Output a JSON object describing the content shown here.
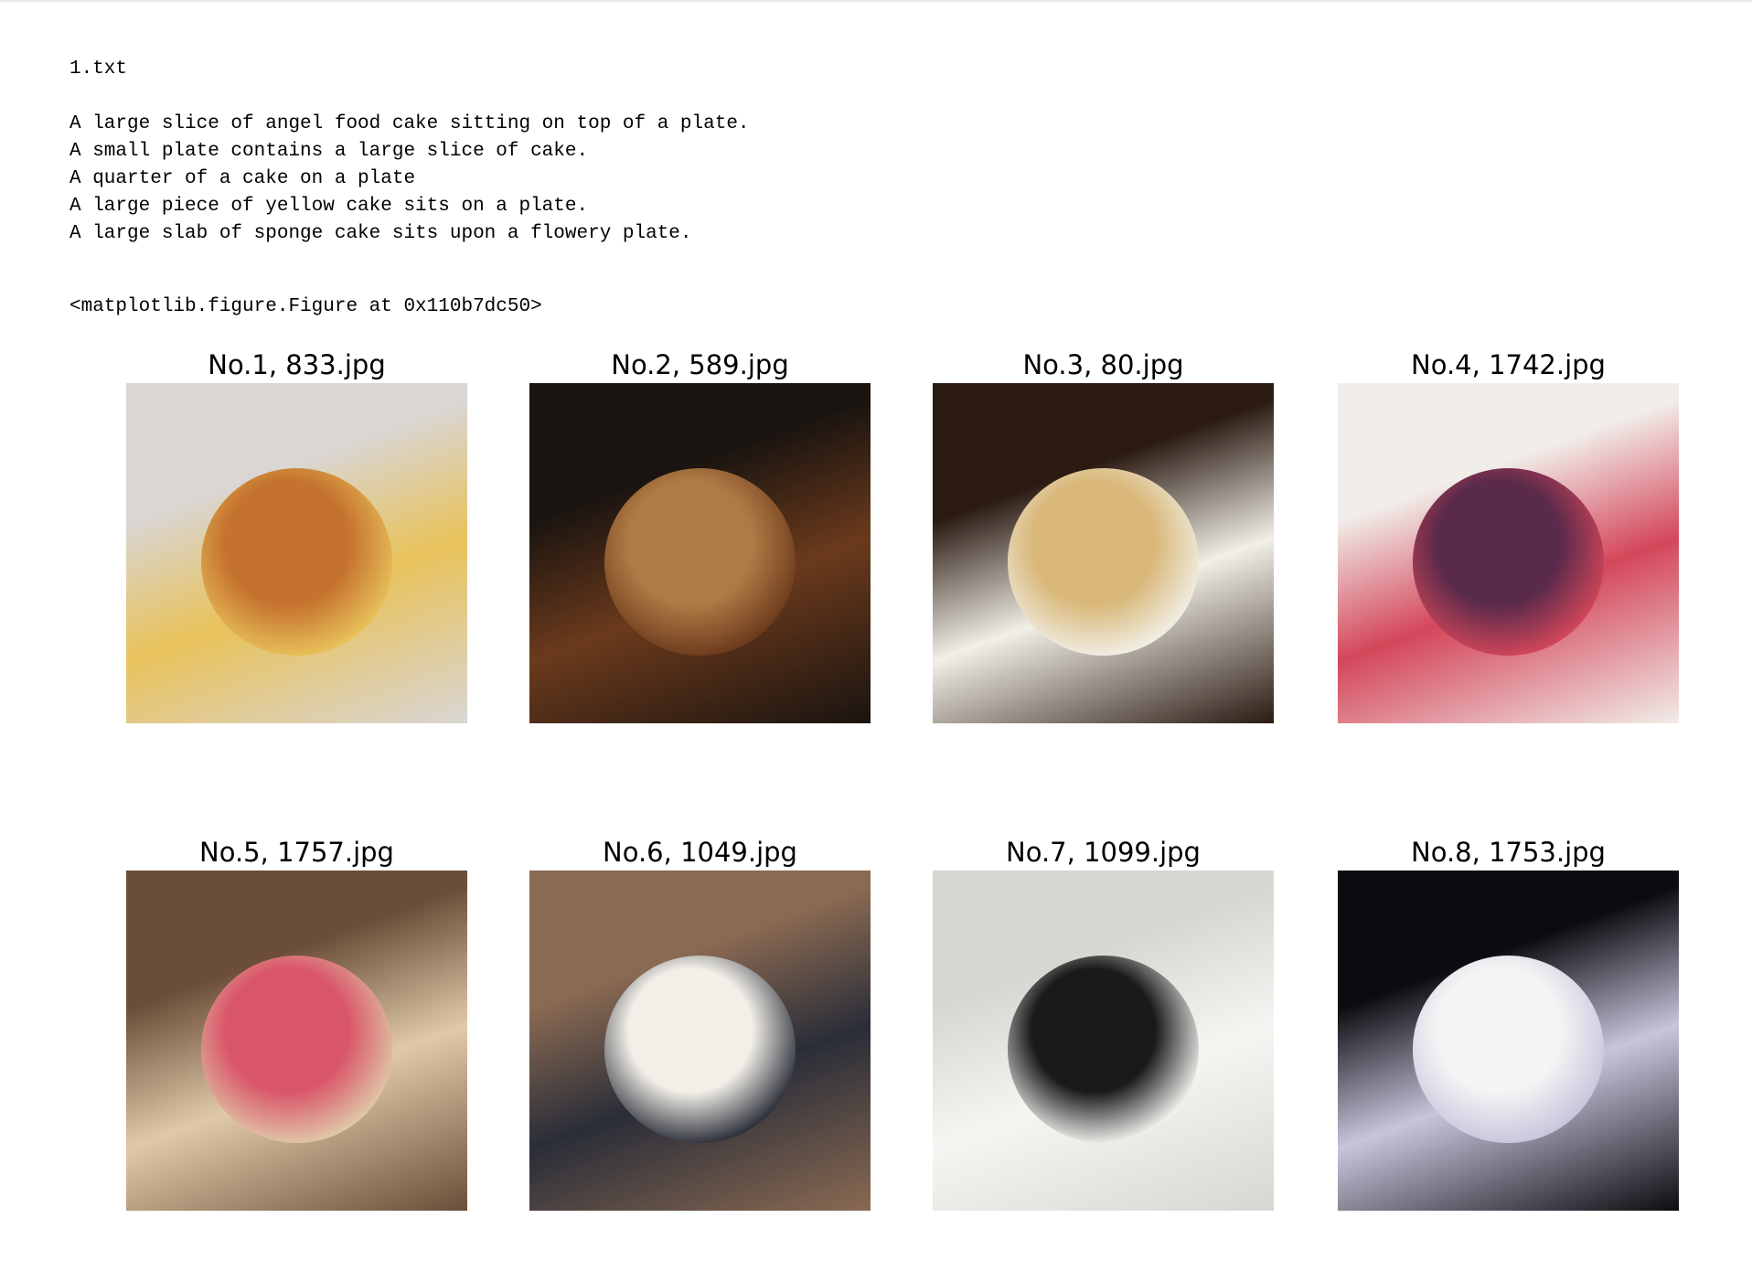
{
  "output": {
    "filename": "1.txt",
    "captions": [
      "A large slice of angel food cake sitting on top of a plate.",
      "A small plate contains a large slice of cake.",
      "A quarter of a cake on a plate",
      "A large piece of yellow cake sits on a plate.",
      "A large slab of sponge cake sits upon a flowery plate."
    ],
    "figure_repr": "<matplotlib.figure.Figure at 0x110b7dc50>"
  },
  "figure": {
    "panels": [
      {
        "title": "No.1, 833.jpg",
        "colors": [
          "#d9d6d4",
          "#e8c25a",
          "#c5722e"
        ]
      },
      {
        "title": "No.2, 589.jpg",
        "colors": [
          "#1a1410",
          "#6b3a1c",
          "#b07a45"
        ]
      },
      {
        "title": "No.3, 80.jpg",
        "colors": [
          "#2a1a12",
          "#f1efe6",
          "#d9b87a"
        ]
      },
      {
        "title": "No.4, 1742.jpg",
        "colors": [
          "#f1ede9",
          "#d4465a",
          "#5a2a4a"
        ]
      },
      {
        "title": "No.5, 1757.jpg",
        "colors": [
          "#6b4e38",
          "#e0c9a8",
          "#d9566a"
        ]
      },
      {
        "title": "No.6, 1049.jpg",
        "colors": [
          "#8a6a52",
          "#2a2d38",
          "#f2efe8"
        ]
      },
      {
        "title": "No.7, 1099.jpg",
        "colors": [
          "#d8d6d2",
          "#f5f5f2",
          "#1a1a1a"
        ]
      },
      {
        "title": "No.8, 1753.jpg",
        "colors": [
          "#0c0c10",
          "#c9c4dc",
          "#f4f4f4"
        ]
      }
    ]
  }
}
